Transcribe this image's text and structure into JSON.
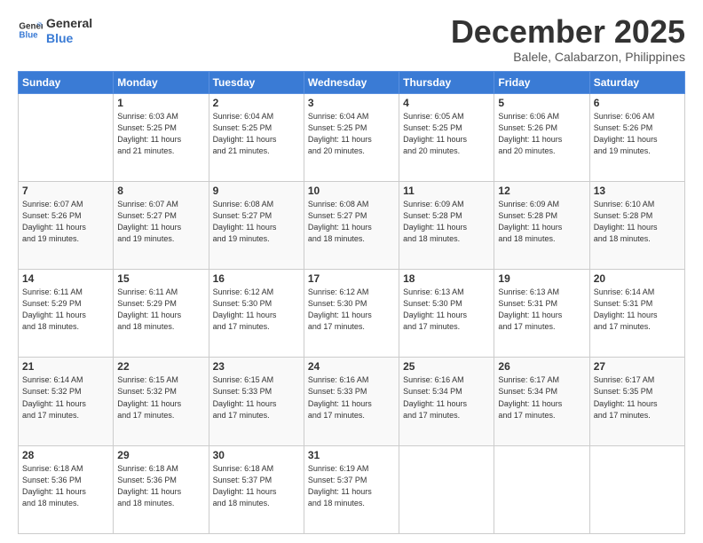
{
  "logo": {
    "line1": "General",
    "line2": "Blue"
  },
  "title": "December 2025",
  "location": "Balele, Calabarzon, Philippines",
  "header_days": [
    "Sunday",
    "Monday",
    "Tuesday",
    "Wednesday",
    "Thursday",
    "Friday",
    "Saturday"
  ],
  "weeks": [
    [
      {
        "day": "",
        "info": ""
      },
      {
        "day": "1",
        "info": "Sunrise: 6:03 AM\nSunset: 5:25 PM\nDaylight: 11 hours\nand 21 minutes."
      },
      {
        "day": "2",
        "info": "Sunrise: 6:04 AM\nSunset: 5:25 PM\nDaylight: 11 hours\nand 21 minutes."
      },
      {
        "day": "3",
        "info": "Sunrise: 6:04 AM\nSunset: 5:25 PM\nDaylight: 11 hours\nand 20 minutes."
      },
      {
        "day": "4",
        "info": "Sunrise: 6:05 AM\nSunset: 5:25 PM\nDaylight: 11 hours\nand 20 minutes."
      },
      {
        "day": "5",
        "info": "Sunrise: 6:06 AM\nSunset: 5:26 PM\nDaylight: 11 hours\nand 20 minutes."
      },
      {
        "day": "6",
        "info": "Sunrise: 6:06 AM\nSunset: 5:26 PM\nDaylight: 11 hours\nand 19 minutes."
      }
    ],
    [
      {
        "day": "7",
        "info": "Sunrise: 6:07 AM\nSunset: 5:26 PM\nDaylight: 11 hours\nand 19 minutes."
      },
      {
        "day": "8",
        "info": "Sunrise: 6:07 AM\nSunset: 5:27 PM\nDaylight: 11 hours\nand 19 minutes."
      },
      {
        "day": "9",
        "info": "Sunrise: 6:08 AM\nSunset: 5:27 PM\nDaylight: 11 hours\nand 19 minutes."
      },
      {
        "day": "10",
        "info": "Sunrise: 6:08 AM\nSunset: 5:27 PM\nDaylight: 11 hours\nand 18 minutes."
      },
      {
        "day": "11",
        "info": "Sunrise: 6:09 AM\nSunset: 5:28 PM\nDaylight: 11 hours\nand 18 minutes."
      },
      {
        "day": "12",
        "info": "Sunrise: 6:09 AM\nSunset: 5:28 PM\nDaylight: 11 hours\nand 18 minutes."
      },
      {
        "day": "13",
        "info": "Sunrise: 6:10 AM\nSunset: 5:28 PM\nDaylight: 11 hours\nand 18 minutes."
      }
    ],
    [
      {
        "day": "14",
        "info": "Sunrise: 6:11 AM\nSunset: 5:29 PM\nDaylight: 11 hours\nand 18 minutes."
      },
      {
        "day": "15",
        "info": "Sunrise: 6:11 AM\nSunset: 5:29 PM\nDaylight: 11 hours\nand 18 minutes."
      },
      {
        "day": "16",
        "info": "Sunrise: 6:12 AM\nSunset: 5:30 PM\nDaylight: 11 hours\nand 17 minutes."
      },
      {
        "day": "17",
        "info": "Sunrise: 6:12 AM\nSunset: 5:30 PM\nDaylight: 11 hours\nand 17 minutes."
      },
      {
        "day": "18",
        "info": "Sunrise: 6:13 AM\nSunset: 5:30 PM\nDaylight: 11 hours\nand 17 minutes."
      },
      {
        "day": "19",
        "info": "Sunrise: 6:13 AM\nSunset: 5:31 PM\nDaylight: 11 hours\nand 17 minutes."
      },
      {
        "day": "20",
        "info": "Sunrise: 6:14 AM\nSunset: 5:31 PM\nDaylight: 11 hours\nand 17 minutes."
      }
    ],
    [
      {
        "day": "21",
        "info": "Sunrise: 6:14 AM\nSunset: 5:32 PM\nDaylight: 11 hours\nand 17 minutes."
      },
      {
        "day": "22",
        "info": "Sunrise: 6:15 AM\nSunset: 5:32 PM\nDaylight: 11 hours\nand 17 minutes."
      },
      {
        "day": "23",
        "info": "Sunrise: 6:15 AM\nSunset: 5:33 PM\nDaylight: 11 hours\nand 17 minutes."
      },
      {
        "day": "24",
        "info": "Sunrise: 6:16 AM\nSunset: 5:33 PM\nDaylight: 11 hours\nand 17 minutes."
      },
      {
        "day": "25",
        "info": "Sunrise: 6:16 AM\nSunset: 5:34 PM\nDaylight: 11 hours\nand 17 minutes."
      },
      {
        "day": "26",
        "info": "Sunrise: 6:17 AM\nSunset: 5:34 PM\nDaylight: 11 hours\nand 17 minutes."
      },
      {
        "day": "27",
        "info": "Sunrise: 6:17 AM\nSunset: 5:35 PM\nDaylight: 11 hours\nand 17 minutes."
      }
    ],
    [
      {
        "day": "28",
        "info": "Sunrise: 6:18 AM\nSunset: 5:36 PM\nDaylight: 11 hours\nand 18 minutes."
      },
      {
        "day": "29",
        "info": "Sunrise: 6:18 AM\nSunset: 5:36 PM\nDaylight: 11 hours\nand 18 minutes."
      },
      {
        "day": "30",
        "info": "Sunrise: 6:18 AM\nSunset: 5:37 PM\nDaylight: 11 hours\nand 18 minutes."
      },
      {
        "day": "31",
        "info": "Sunrise: 6:19 AM\nSunset: 5:37 PM\nDaylight: 11 hours\nand 18 minutes."
      },
      {
        "day": "",
        "info": ""
      },
      {
        "day": "",
        "info": ""
      },
      {
        "day": "",
        "info": ""
      }
    ]
  ]
}
